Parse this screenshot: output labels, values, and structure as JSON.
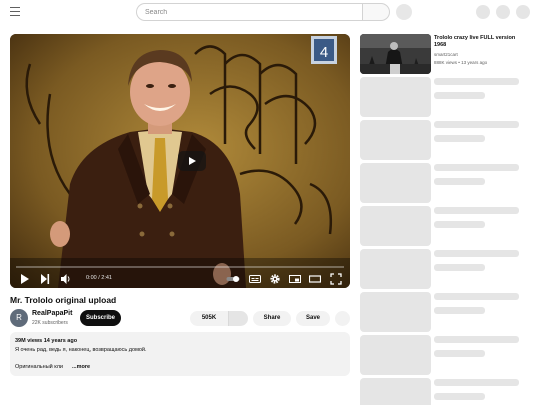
{
  "search": {
    "placeholder": "Search"
  },
  "player": {
    "time": "0:00 / 2:41",
    "channel_badge": "4"
  },
  "video": {
    "title": "Mr. Trololo original upload",
    "channel": "RealPapaPit",
    "avatar_letter": "R",
    "subscribers": "22K subscribers",
    "subscribe_label": "Subscribe",
    "likes": "505K",
    "share_label": "Share",
    "save_label": "Save"
  },
  "description": {
    "meta": "39M views  14 years ago",
    "line1": "Я очень рад, ведь я, наконец, возвращаюсь домой.",
    "line2": "Оригинальный кли",
    "more_label": "...more"
  },
  "recommendations": [
    {
      "title": "Trololo crazy live FULL version 1968",
      "channel": "smart21cart",
      "stats": "888K views • 13 years ago"
    }
  ],
  "icons": {
    "menu": "menu-icon",
    "play": "play-icon",
    "next": "next-icon",
    "volume": "volume-icon",
    "autoplay": "autoplay-toggle-icon",
    "subtitles": "subtitles-icon",
    "settings": "gear-icon",
    "miniplayer": "miniplayer-icon",
    "theater": "theater-icon",
    "fullscreen": "fullscreen-icon"
  },
  "colors": {
    "subscribe_bg": "#0f0f0f",
    "placeholder_gray": "#e5e5e5",
    "pill_gray": "#f2f2f2"
  }
}
